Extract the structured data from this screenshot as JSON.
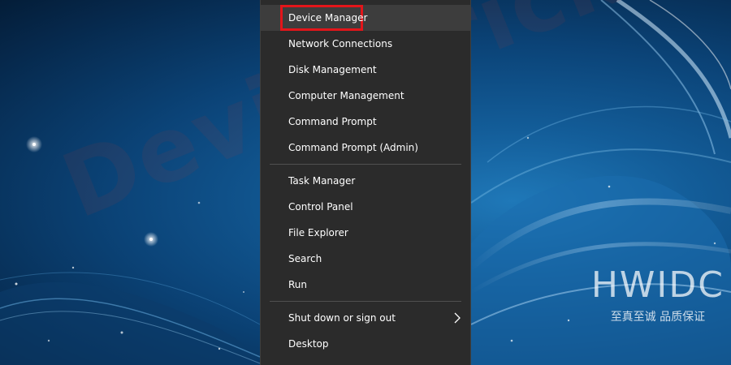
{
  "background": {
    "watermark_brand": "DeviceTricks",
    "watermark_logo": "HWIDC",
    "watermark_logo_subtitle": "至真至诚 品质保证"
  },
  "menu": {
    "groups": [
      {
        "items": [
          {
            "label": "Device Manager",
            "highlighted": true
          },
          {
            "label": "Network Connections"
          },
          {
            "label": "Disk Management"
          },
          {
            "label": "Computer Management"
          },
          {
            "label": "Command Prompt"
          },
          {
            "label": "Command Prompt (Admin)"
          }
        ]
      },
      {
        "items": [
          {
            "label": "Task Manager"
          },
          {
            "label": "Control Panel"
          },
          {
            "label": "File Explorer"
          },
          {
            "label": "Search"
          },
          {
            "label": "Run"
          }
        ]
      },
      {
        "items": [
          {
            "label": "Shut down or sign out",
            "submenu_icon": "chevron-right-icon"
          },
          {
            "label": "Desktop"
          }
        ]
      }
    ]
  },
  "colors": {
    "menu_background": "#2b2b2b",
    "hover_background": "#3d3d3d",
    "highlight_border": "#e3151a",
    "text": "#ffffff"
  }
}
